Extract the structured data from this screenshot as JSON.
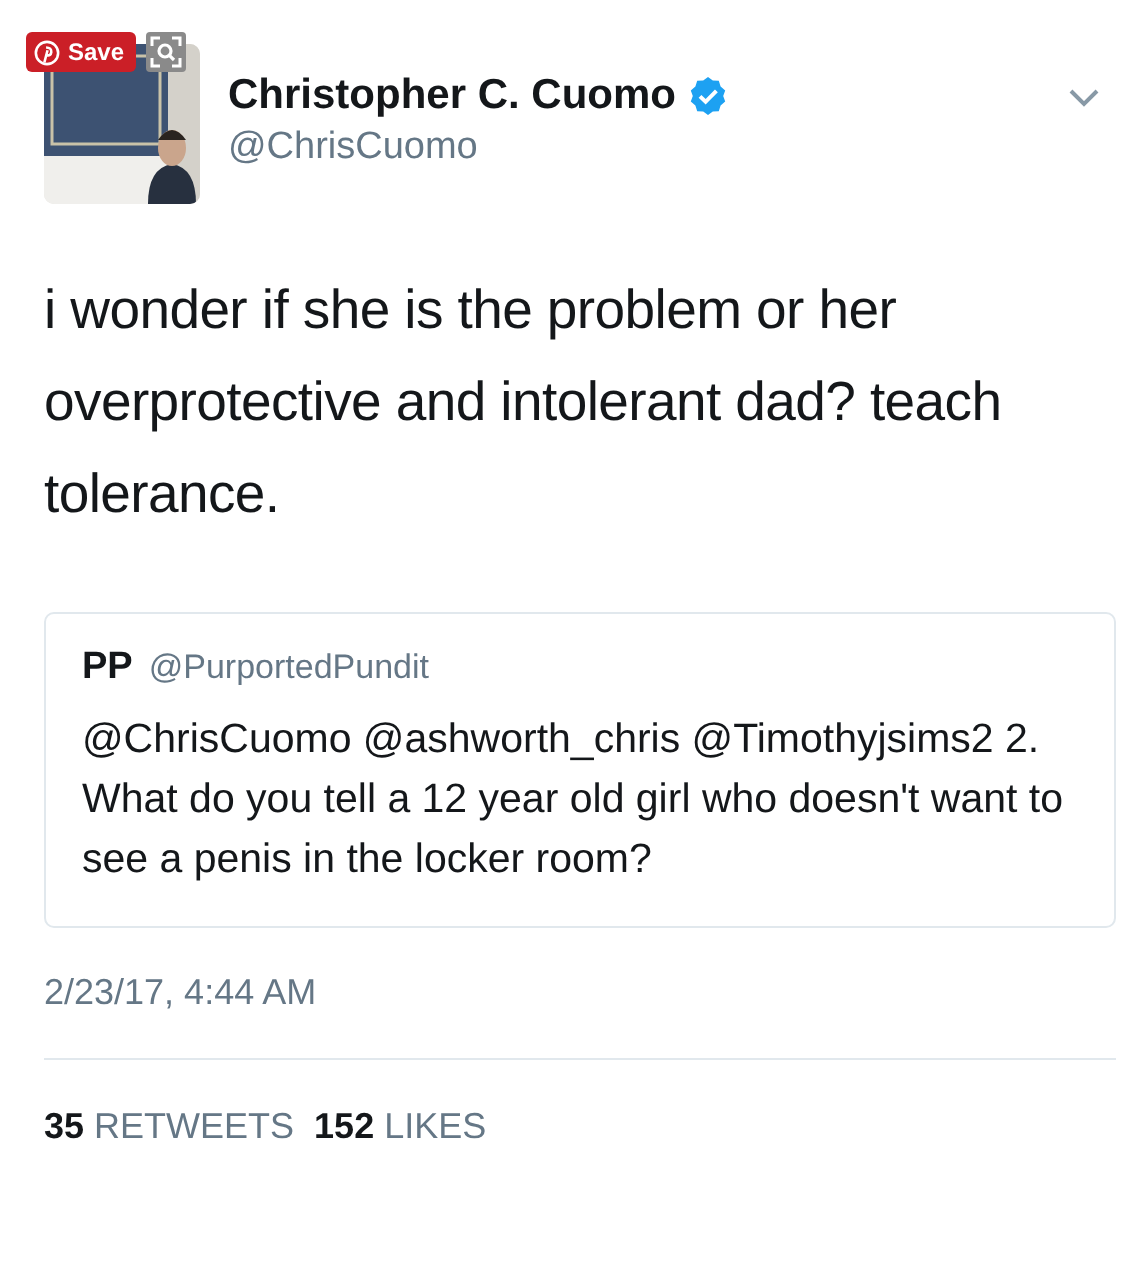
{
  "overlay": {
    "save_label": "Save"
  },
  "author": {
    "name": "Christopher C. Cuomo",
    "handle": "@ChrisCuomo",
    "verified": true
  },
  "text": "i wonder if she is the problem or her overprotective and intolerant dad? teach tolerance.",
  "quoted": {
    "name": "PP",
    "handle": "@PurportedPundit",
    "text": "@ChrisCuomo @ashworth_chris @Timothyjsims2 2. What do you tell a 12 year old girl who doesn't want to see a penis in the locker room?"
  },
  "timestamp": "2/23/17, 4:44 AM",
  "stats": [
    {
      "count": "35",
      "label": "RETWEETS"
    },
    {
      "count": "152",
      "label": "LIKES"
    }
  ]
}
